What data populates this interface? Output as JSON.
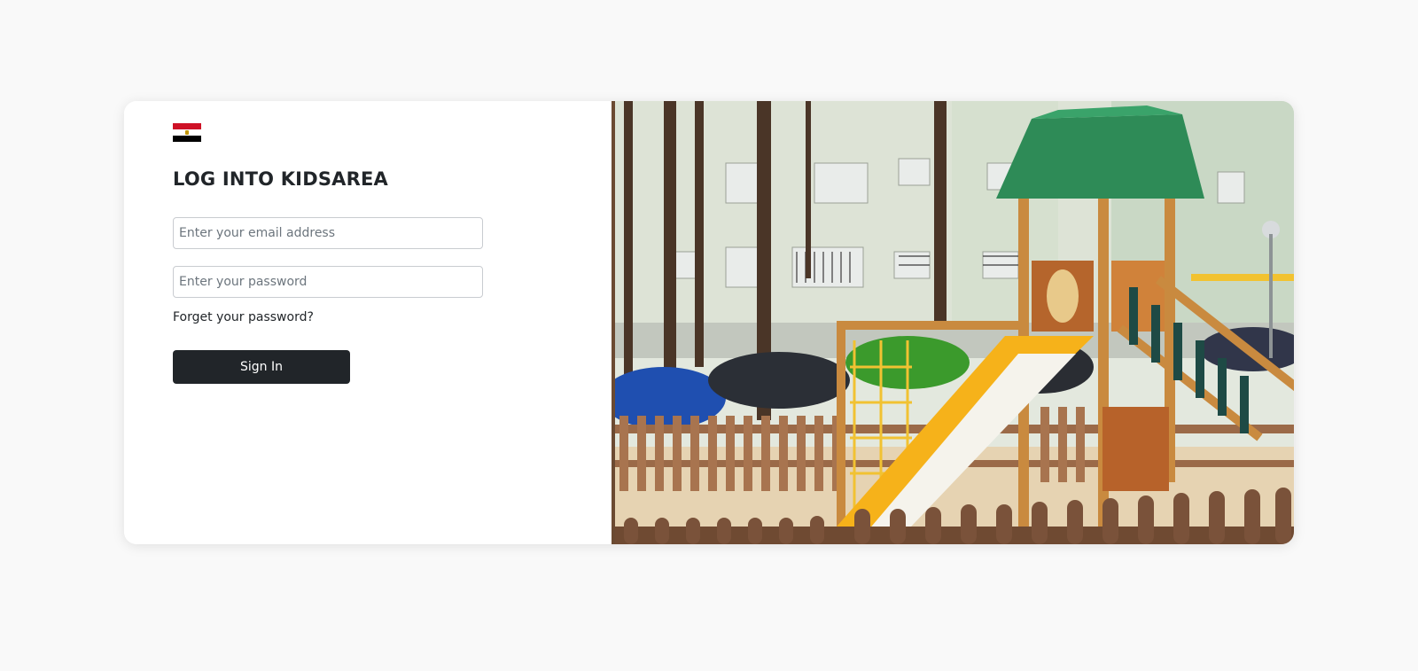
{
  "login": {
    "flag_icon": "egypt-flag-icon",
    "title": "LOG INTO KIDSAREA",
    "email_placeholder": "Enter your email address",
    "password_placeholder": "Enter your password",
    "forgot_label": "Forget your password?",
    "signin_label": "Sign In"
  },
  "hero": {
    "image": "playground-photo",
    "scene_colors": {
      "roof": "#2e8b57",
      "slide": "#f7b51b",
      "fence": "#8b5a3c",
      "building": "#dfe7d6",
      "sand": "#e8d5b5"
    }
  }
}
